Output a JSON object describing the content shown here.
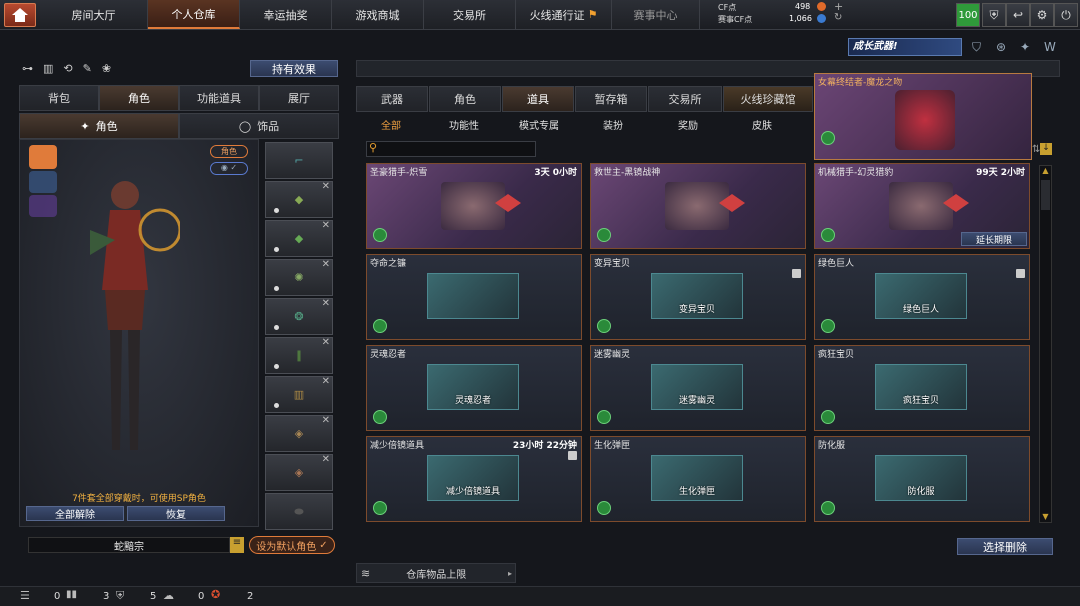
{
  "top_nav": {
    "tabs": [
      "房间大厅",
      "个人仓库",
      "幸运抽奖",
      "游戏商城",
      "交易所",
      "火线通行证",
      "赛事中心"
    ],
    "active_index": 1
  },
  "currency": {
    "cf_label": "CF点",
    "cf_value": "498",
    "game_cf_label": "赛事CF点",
    "game_cf_value": "1,066"
  },
  "top_right": {
    "level": "100"
  },
  "left": {
    "effect_button": "持有效果",
    "tabs": [
      "背包",
      "角色",
      "功能道具",
      "展厅"
    ],
    "subtabs": [
      "角色",
      "饰品"
    ],
    "badges": [
      "角色",
      "✓"
    ],
    "note": "7件套全部穿戴时，可使用SP角色",
    "unequip_all": "全部解除",
    "restore": "恢复",
    "char_name": "蛇黯宗",
    "set_default": "设为默认角色"
  },
  "right": {
    "banner": "成长武器!",
    "tabs": [
      "武器",
      "角色",
      "道具",
      "暂存箱",
      "交易所",
      "火线珍藏馆"
    ],
    "active_tab": 2,
    "subtabs": [
      "全部",
      "功能性",
      "模式专属",
      "装扮",
      "奖励",
      "皮肤"
    ],
    "featured": {
      "title": "女幕终结者-魔龙之吻"
    },
    "cards": [
      {
        "title": "圣豪猎手-炽雪",
        "time": "3天 0小时",
        "style": "purple",
        "caption": ""
      },
      {
        "title": "救世主-黑镜战神",
        "time": "",
        "style": "purple",
        "caption": ""
      },
      {
        "title": "机械猎手-幻灵猎豹",
        "time": "99天 2小时",
        "style": "purple",
        "caption": "",
        "extend": "延长期限"
      },
      {
        "title": "夺命之镰",
        "time": "",
        "style": "blue",
        "caption": ""
      },
      {
        "title": "变异宝贝",
        "time": "",
        "style": "blue",
        "caption": "变异宝贝",
        "lock": true
      },
      {
        "title": "绿色巨人",
        "time": "",
        "style": "blue",
        "caption": "绿色巨人",
        "lock": true
      },
      {
        "title": "灵魂忍者",
        "time": "",
        "style": "blue",
        "caption": "灵魂忍者"
      },
      {
        "title": "迷雾幽灵",
        "time": "",
        "style": "blue",
        "caption": "迷雾幽灵"
      },
      {
        "title": "疯狂宝贝",
        "time": "",
        "style": "blue",
        "caption": "疯狂宝贝"
      },
      {
        "title": "减少倍镜道具",
        "time": "23小时 22分钟",
        "style": "blue",
        "caption": "减少倍镜道具",
        "lock": true
      },
      {
        "title": "生化弹匣",
        "time": "",
        "style": "blue",
        "caption": "生化弹匣"
      },
      {
        "title": "防化服",
        "time": "",
        "style": "blue",
        "caption": "防化服"
      }
    ],
    "select_delete": "选择删除",
    "warehouse_limit": "仓库物品上限"
  },
  "bottom": {
    "counts": [
      "0",
      "3",
      "5",
      "0",
      "2"
    ]
  }
}
